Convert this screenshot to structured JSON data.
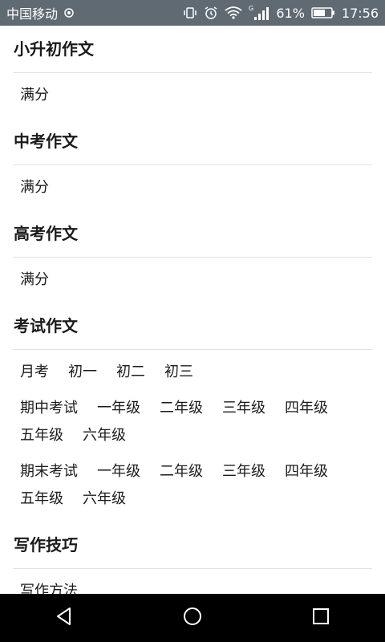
{
  "status_bar": {
    "carrier": "中国移动",
    "network_label": "G",
    "battery": "61%",
    "time": "17:56",
    "icons": [
      "hotspot-icon",
      "vibrate-icon",
      "alarm-icon",
      "wifi-icon",
      "signal-icon",
      "battery-icon"
    ]
  },
  "sections": [
    {
      "title": "小升初作文",
      "rows": [
        [
          "满分"
        ]
      ]
    },
    {
      "title": "中考作文",
      "rows": [
        [
          "满分"
        ]
      ]
    },
    {
      "title": "高考作文",
      "rows": [
        [
          "满分"
        ]
      ]
    },
    {
      "title": "考试作文",
      "rows": [
        [
          "月考",
          "初一",
          "初二",
          "初三"
        ],
        [
          "期中考试",
          "一年级",
          "二年级",
          "三年级",
          "四年级",
          "五年级",
          "六年级"
        ],
        [
          "期末考试",
          "一年级",
          "二年级",
          "三年级",
          "四年级",
          "五年级",
          "六年级"
        ]
      ]
    },
    {
      "title": "写作技巧",
      "rows": [
        [
          "写作方法"
        ]
      ]
    }
  ],
  "nav_bar": {
    "icons": [
      "back-icon",
      "home-icon",
      "recents-icon"
    ]
  },
  "colors": {
    "status_bar_bg": "#5f6a73",
    "nav_bar_bg": "#000000",
    "divider": "#e2e2e2"
  }
}
